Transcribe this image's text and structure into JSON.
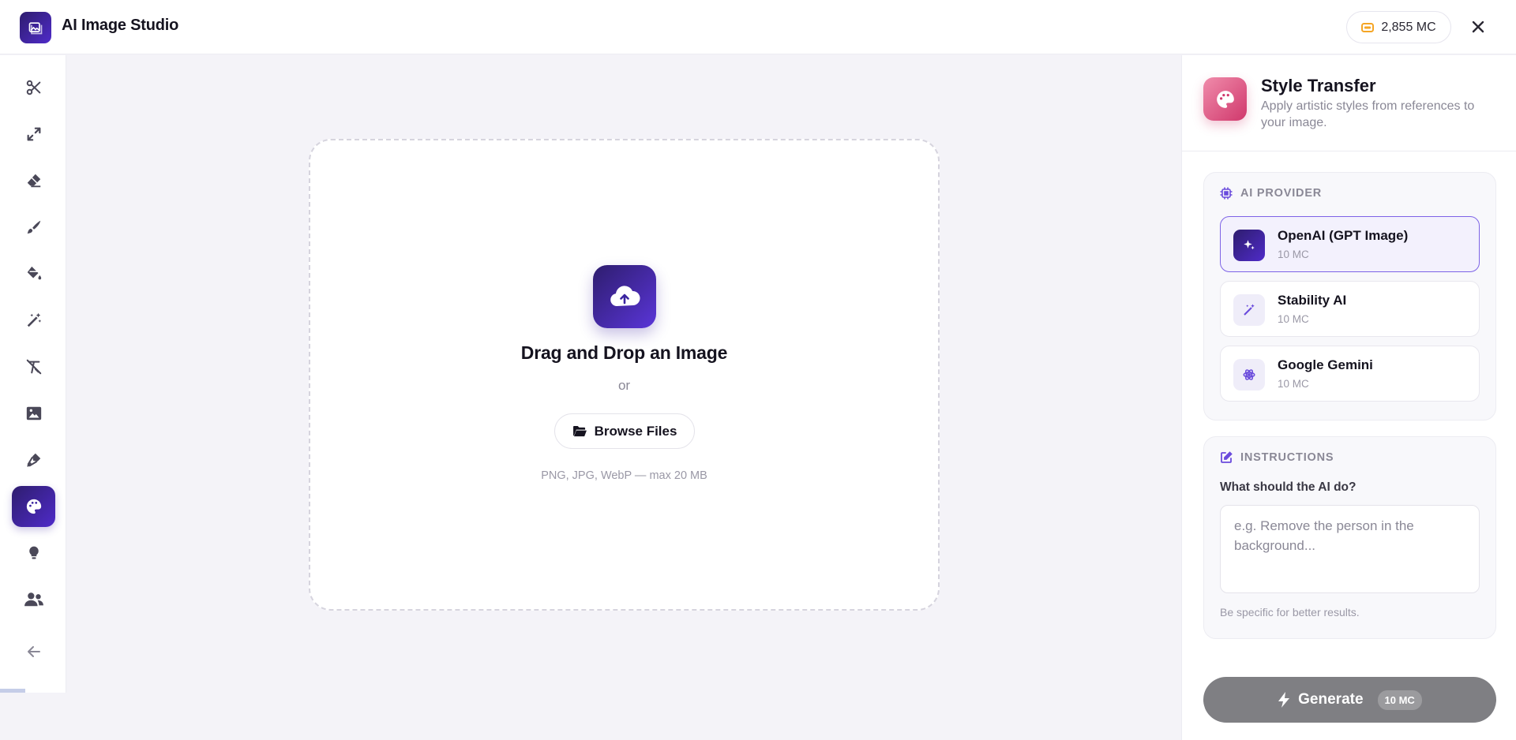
{
  "header": {
    "title": "AI Image Studio",
    "credits": "2,855 MC"
  },
  "sidebar": {
    "tools": [
      {
        "icon": "scissors-icon"
      },
      {
        "icon": "expand-icon"
      },
      {
        "icon": "eraser-icon"
      },
      {
        "icon": "brush-icon"
      },
      {
        "icon": "paint-bucket-icon"
      },
      {
        "icon": "magic-wand-icon"
      },
      {
        "icon": "remove-text-icon"
      },
      {
        "icon": "image-icon"
      },
      {
        "icon": "pen-nib-icon"
      },
      {
        "icon": "palette-icon",
        "active": true
      },
      {
        "icon": "lightbulb-icon"
      },
      {
        "icon": "users-icon"
      },
      {
        "icon": "arrow-left-icon"
      }
    ]
  },
  "dropzone": {
    "title": "Drag and Drop an Image",
    "or": "or",
    "browse_label": "Browse Files",
    "hint": "PNG, JPG, WebP — max 20 MB"
  },
  "panel": {
    "title": "Style Transfer",
    "subtitle": "Apply artistic styles from references to your image.",
    "provider_label": "AI PROVIDER",
    "providers": [
      {
        "name": "OpenAI (GPT Image)",
        "cost": "10 MC",
        "selected": true
      },
      {
        "name": "Stability AI",
        "cost": "10 MC",
        "selected": false
      },
      {
        "name": "Google Gemini",
        "cost": "10 MC",
        "selected": false
      }
    ],
    "instructions_label": "INSTRUCTIONS",
    "instructions_question": "What should the AI do?",
    "instructions_placeholder": "e.g. Remove the person in the background...",
    "instructions_hint": "Be specific for better results.",
    "generate_label": "Generate",
    "generate_cost": "10 MC"
  },
  "colors": {
    "accent": "#4f2bc9",
    "accent_dark": "#2e1d6e",
    "style_icon": "#d0386c",
    "credit_coin": "#f5a524",
    "generate_disabled": "#7f7f83"
  }
}
